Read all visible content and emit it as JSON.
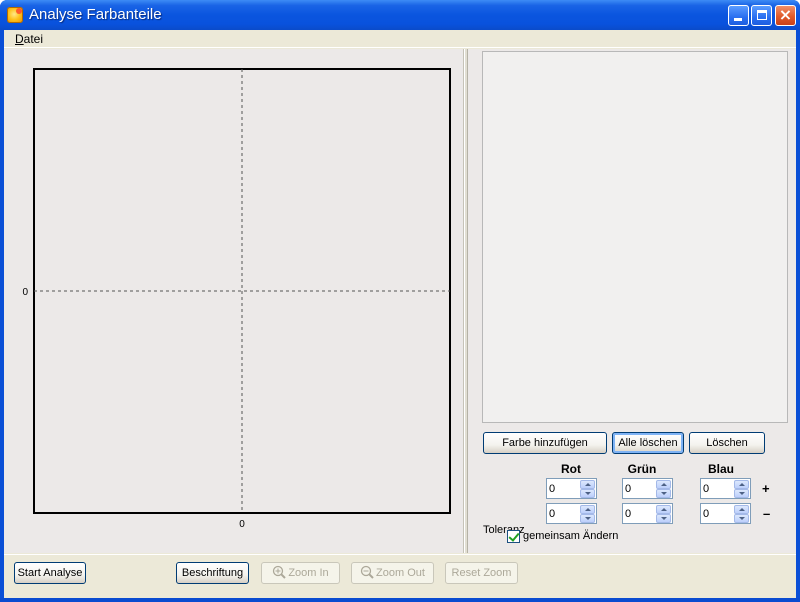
{
  "window": {
    "title": "Analyse Farbanteile",
    "icon": "app-sun-icon"
  },
  "menu": {
    "items": [
      {
        "label": "Datei"
      }
    ]
  },
  "plot": {
    "x_tick_label": "0",
    "y_tick_label": "0",
    "x_range": [
      -1,
      1
    ],
    "y_range": [
      -1,
      1
    ],
    "crosshair": {
      "x": 0,
      "y": 0
    }
  },
  "color_list": {
    "items": []
  },
  "color_buttons": {
    "add": "Farbe hinzufügen",
    "clear_all": "Alle löschen",
    "delete": "Löschen"
  },
  "tolerance": {
    "label": "Toleranz",
    "columns": [
      "Rot",
      "Grün",
      "Blau"
    ],
    "plus_sign": "+",
    "minus_sign": "–",
    "plus_values": [
      "0",
      "0",
      "0"
    ],
    "minus_values": [
      "0",
      "0",
      "0"
    ],
    "change_together_label": "gemeinsam Ändern",
    "change_together_checked": true
  },
  "bottom_buttons": {
    "start": "Start Analyse",
    "labels": "Beschriftung",
    "zoom_in": "Zoom In",
    "zoom_out": "Zoom Out",
    "reset_zoom": "Reset Zoom"
  }
}
